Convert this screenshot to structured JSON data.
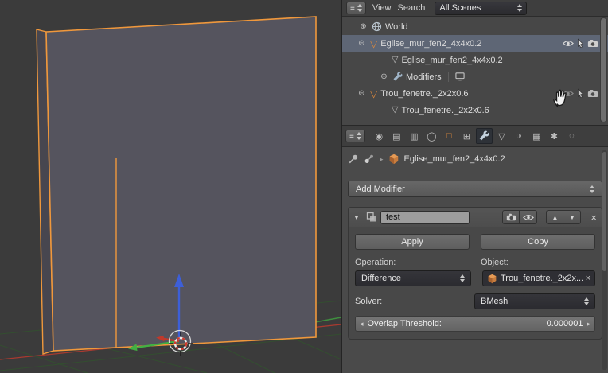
{
  "outliner": {
    "editor_icon_glyph": "≡",
    "menus": {
      "view": "View",
      "search": "Search"
    },
    "display_mode": "All Scenes",
    "rows": [
      {
        "label": "World"
      },
      {
        "label": "Eglise_mur_fen2_4x4x0.2"
      },
      {
        "label": "Eglise_mur_fen2_4x4x0.2"
      },
      {
        "label": "Modifiers"
      },
      {
        "label": "Trou_fenetre._2x2x0.6"
      },
      {
        "label": "Trou_fenetre._2x2x0.6"
      }
    ]
  },
  "properties": {
    "editor_icon_glyph": "≡",
    "tabs": [
      {
        "name": "render-icon",
        "glyph": "◉"
      },
      {
        "name": "render-layers-icon",
        "glyph": "▤"
      },
      {
        "name": "scene-icon",
        "glyph": "▥"
      },
      {
        "name": "world-icon",
        "glyph": "◯"
      },
      {
        "name": "object-icon",
        "glyph": "□"
      },
      {
        "name": "constraints-icon",
        "glyph": "⊞"
      },
      {
        "name": "modifiers-icon",
        "glyph": ""
      },
      {
        "name": "object-data-icon",
        "glyph": "▽"
      },
      {
        "name": "material-icon",
        "glyph": "◑"
      },
      {
        "name": "texture-icon",
        "glyph": "▦"
      },
      {
        "name": "particles-icon",
        "glyph": "✱"
      },
      {
        "name": "physics-icon",
        "glyph": "◌"
      }
    ],
    "breadcrumb": {
      "object_name": "Eglise_mur_fen2_4x4x0.2"
    },
    "add_modifier_label": "Add Modifier",
    "modifier": {
      "name": "test",
      "apply_label": "Apply",
      "copy_label": "Copy",
      "operation_label": "Operation:",
      "object_label": "Object:",
      "operation_value": "Difference",
      "object_value": "Trou_fenetre._2x2x...",
      "solver_label": "Solver:",
      "solver_value": "BMesh",
      "overlap_label": "Overlap Threshold:",
      "overlap_value": "0.000001"
    }
  },
  "icons": {
    "collapse": "⊖",
    "expand": "⊕",
    "mesh_triangle": "▽",
    "close": "×",
    "panel_collapse": "▼",
    "arrow_up": "▲",
    "arrow_down": "▼",
    "slider_left": "◂",
    "slider_right": "▸",
    "crumb_arrow": "▸"
  },
  "colors": {
    "selection_orange": "#f0983c",
    "selected_row": "#5e6675",
    "axis_x_red": "#c0392b",
    "axis_y_green": "#42b042",
    "axis_z_blue": "#3d5fd8",
    "wall_face": "#55545e",
    "grid_green": "#33512f"
  }
}
